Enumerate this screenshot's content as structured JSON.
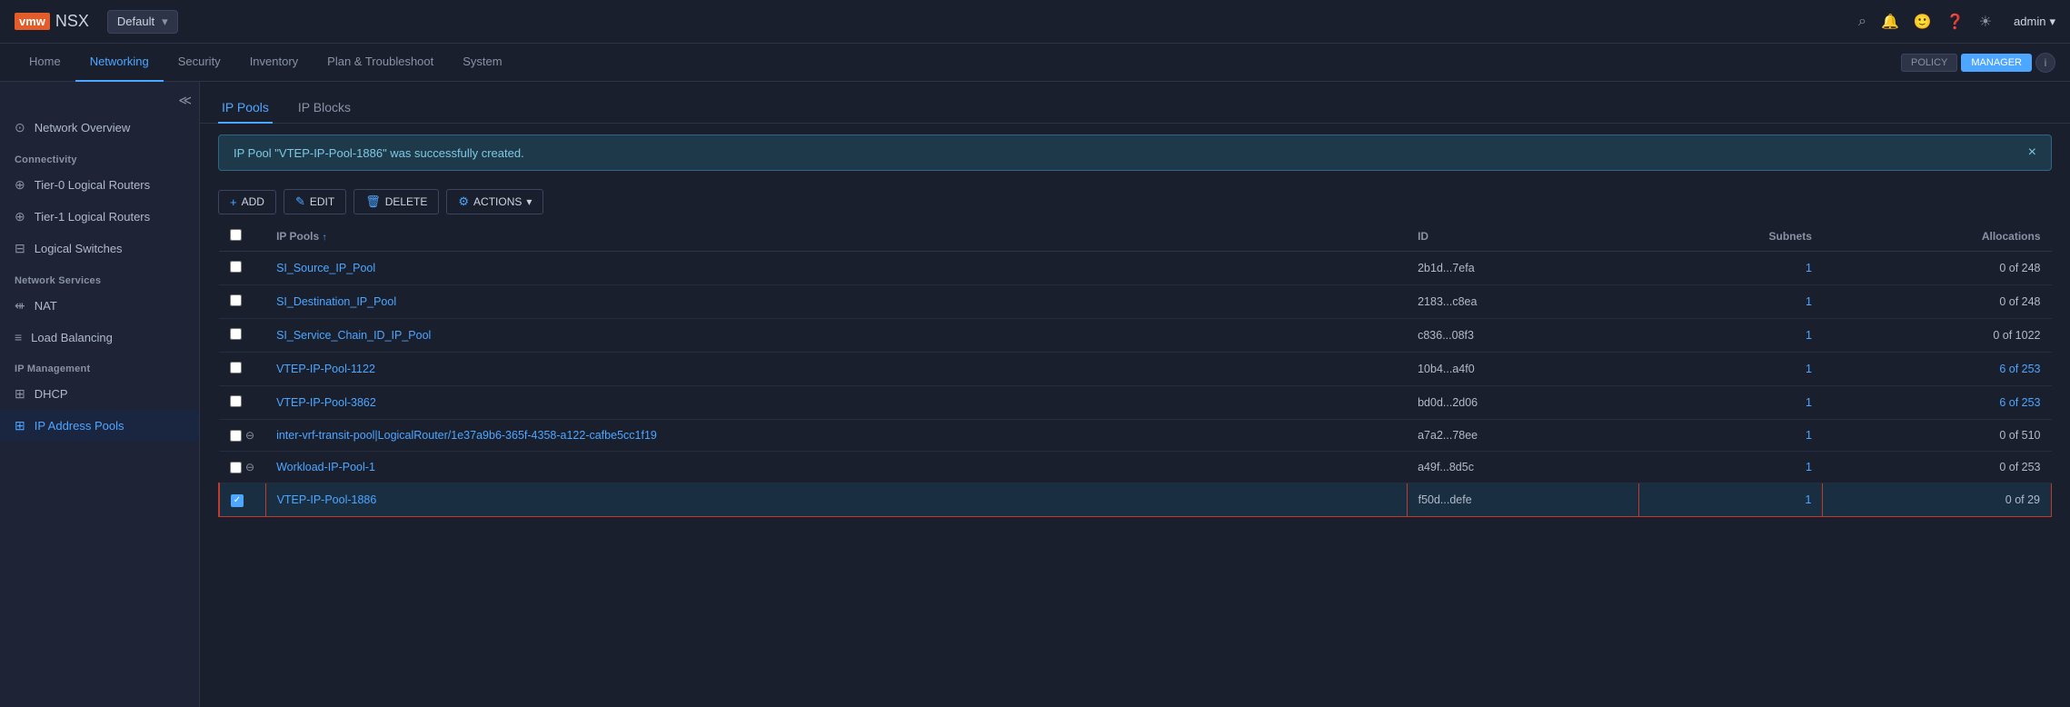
{
  "topbar": {
    "logo": "vmw",
    "product": "NSX",
    "instance": "Default",
    "icons": [
      "search",
      "bell",
      "face",
      "help",
      "sun"
    ],
    "user": "admin"
  },
  "nav": {
    "items": [
      "Home",
      "Networking",
      "Security",
      "Inventory",
      "Plan & Troubleshoot",
      "System"
    ],
    "active": "Networking",
    "policy_label": "POLICY",
    "manager_label": "MANAGER",
    "info_label": "i"
  },
  "sidebar": {
    "sections": [
      {
        "label": "",
        "items": [
          {
            "id": "network-overview",
            "icon": "⊙",
            "label": "Network Overview"
          }
        ]
      },
      {
        "label": "Connectivity",
        "items": [
          {
            "id": "tier0-routers",
            "icon": "⊕",
            "label": "Tier-0 Logical Routers"
          },
          {
            "id": "tier1-routers",
            "icon": "⊕",
            "label": "Tier-1 Logical Routers"
          },
          {
            "id": "logical-switches",
            "icon": "⊟",
            "label": "Logical Switches"
          }
        ]
      },
      {
        "label": "Network Services",
        "items": [
          {
            "id": "nat",
            "icon": "⟺",
            "label": "NAT"
          },
          {
            "id": "load-balancing",
            "icon": "≡",
            "label": "Load Balancing"
          }
        ]
      },
      {
        "label": "IP Management",
        "items": [
          {
            "id": "dhcp",
            "icon": "▦",
            "label": "DHCP"
          },
          {
            "id": "ip-address-pools",
            "icon": "▦",
            "label": "IP Address Pools",
            "active": true
          }
        ]
      }
    ]
  },
  "content": {
    "tabs": [
      {
        "id": "ip-pools",
        "label": "IP Pools",
        "active": true
      },
      {
        "id": "ip-blocks",
        "label": "IP Blocks"
      }
    ],
    "notification": {
      "message": "IP Pool \"VTEP-IP-Pool-1886\" was successfully created.",
      "close": "×"
    },
    "toolbar": {
      "add": "+ ADD",
      "edit": "✎ EDIT",
      "delete": "🗑 DELETE",
      "actions": "⚙ ACTIONS ▾"
    },
    "table": {
      "columns": [
        "IP Pools ↑",
        "ID",
        "Subnets",
        "Allocations"
      ],
      "rows": [
        {
          "name": "SI_Source_IP_Pool",
          "id": "2b1d...7efa",
          "subnets": "1",
          "allocations": "0 of 248",
          "selected": false,
          "alloc_colored": false
        },
        {
          "name": "SI_Destination_IP_Pool",
          "id": "2183...c8ea",
          "subnets": "1",
          "allocations": "0 of 248",
          "selected": false,
          "alloc_colored": false
        },
        {
          "name": "SI_Service_Chain_ID_IP_Pool",
          "id": "c836...08f3",
          "subnets": "1",
          "allocations": "0 of 1022",
          "selected": false,
          "alloc_colored": false
        },
        {
          "name": "VTEP-IP-Pool-1122",
          "id": "10b4...a4f0",
          "subnets": "1",
          "allocations": "6 of 253",
          "selected": false,
          "alloc_colored": true
        },
        {
          "name": "VTEP-IP-Pool-3862",
          "id": "bd0d...2d06",
          "subnets": "1",
          "allocations": "6 of 253",
          "selected": false,
          "alloc_colored": true
        },
        {
          "name": "inter-vrf-transit-pool|LogicalRouter/1e37a9b6-365f-4358-a122-cafbe5cc1f19",
          "id": "a7a2...78ee",
          "subnets": "1",
          "allocations": "0 of 510",
          "selected": false,
          "alloc_colored": false,
          "has_minus": true
        },
        {
          "name": "Workload-IP-Pool-1",
          "id": "a49f...8d5c",
          "subnets": "1",
          "allocations": "0 of 253",
          "selected": false,
          "alloc_colored": false,
          "has_minus": true
        },
        {
          "name": "VTEP-IP-Pool-1886",
          "id": "f50d...defe",
          "subnets": "1",
          "allocations": "0 of 29",
          "selected": true,
          "alloc_colored": false
        }
      ]
    }
  }
}
